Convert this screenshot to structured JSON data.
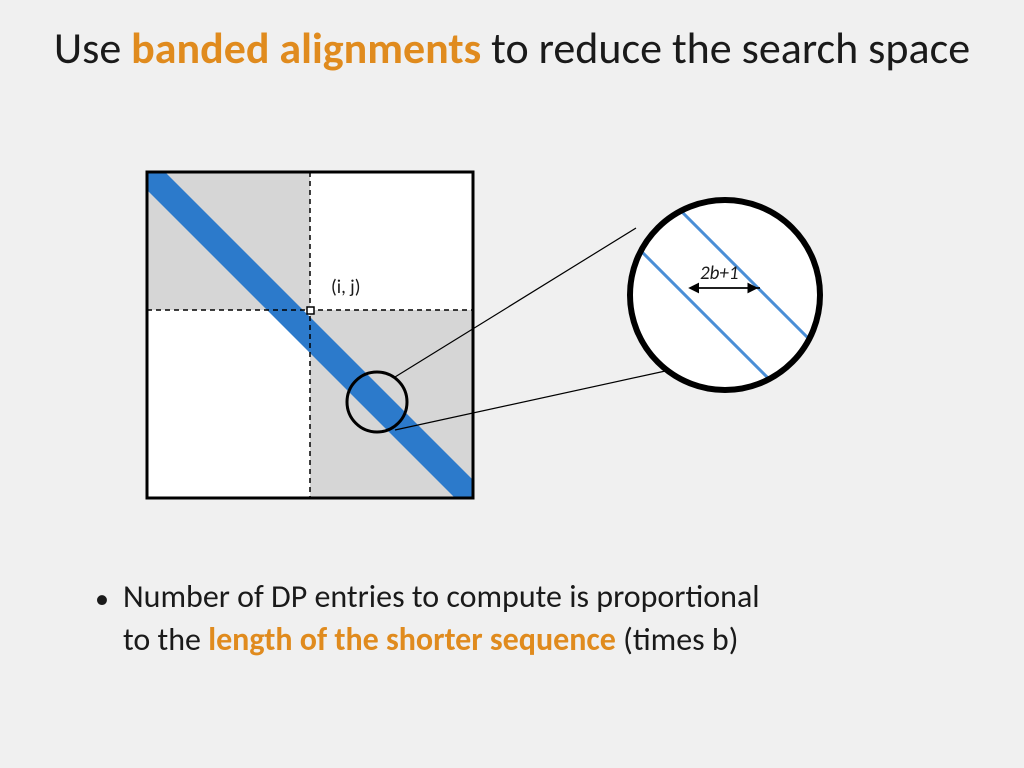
{
  "title": {
    "pre": "Use ",
    "highlight": "banded alignments",
    "post": " to reduce the search space"
  },
  "diagram": {
    "point_label": "(i, j)",
    "band_width_label": "2b+1"
  },
  "bullet": {
    "pre": "Number of DP entries to compute is proportional to the ",
    "highlight": "length of the shorter sequence",
    "post": " (times b)"
  },
  "colors": {
    "accent": "#e08b1e",
    "band": "#2c7acb",
    "band_light": "#4a8ed6",
    "shade": "#d6d6d6"
  }
}
